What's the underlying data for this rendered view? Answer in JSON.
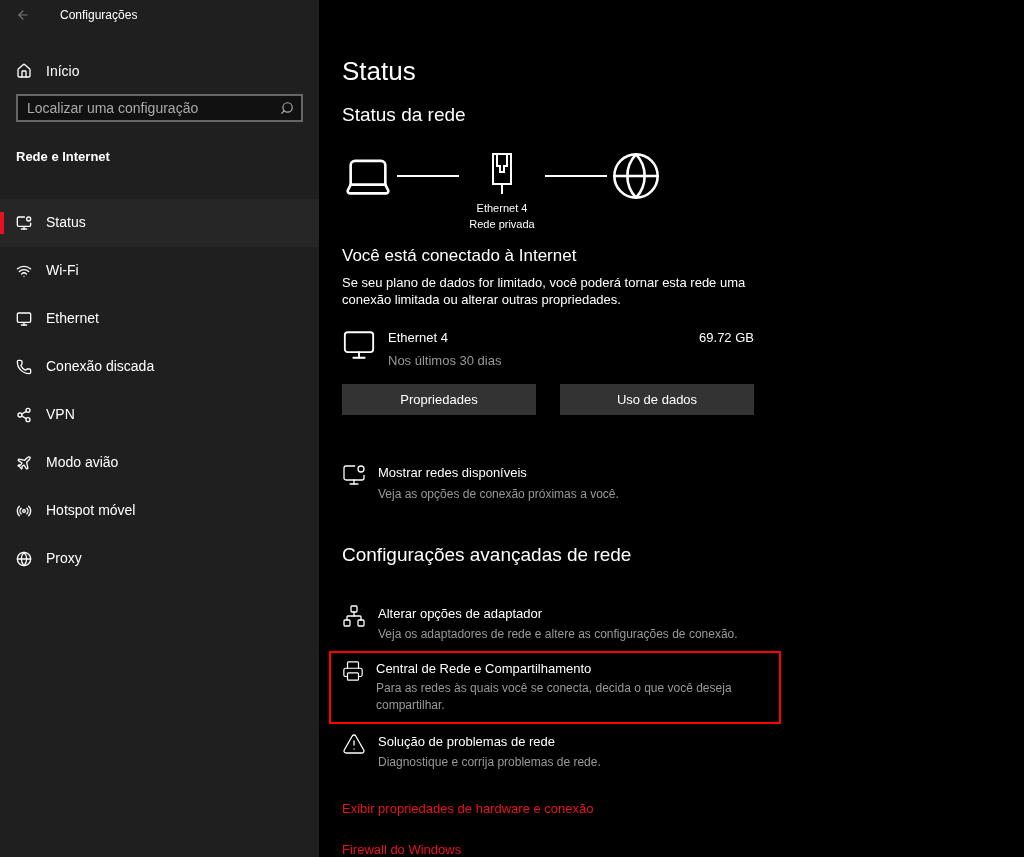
{
  "window": {
    "title": "Configurações"
  },
  "sidebar": {
    "home": "Início",
    "search": {
      "placeholder": "Localizar uma configuração"
    },
    "section": "Rede e Internet",
    "items": [
      {
        "label": "Status",
        "selected": true
      },
      {
        "label": "Wi-Fi",
        "selected": false
      },
      {
        "label": "Ethernet",
        "selected": false
      },
      {
        "label": "Conexão discada",
        "selected": false
      },
      {
        "label": "VPN",
        "selected": false
      },
      {
        "label": "Modo avião",
        "selected": false
      },
      {
        "label": "Hotspot móvel",
        "selected": false
      },
      {
        "label": "Proxy",
        "selected": false
      }
    ]
  },
  "main": {
    "title": "Status",
    "network_status": {
      "heading": "Status da rede",
      "adapter_name": "Ethernet 4",
      "network_type": "Rede privada"
    },
    "connected_heading": "Você está conectado à Internet",
    "description": "Se seu plano de dados for limitado, você poderá tornar esta rede uma conexão limitada ou alterar outras propriedades.",
    "usage": {
      "name": "Ethernet 4",
      "period": "Nos últimos 30 dias",
      "amount": "69.72 GB"
    },
    "buttons": [
      "Propriedades",
      "Uso de dados"
    ],
    "show_networks": {
      "title": "Mostrar redes disponíveis",
      "subtitle": "Veja as opções de conexão próximas a você."
    },
    "advanced_heading": "Configurações avançadas de rede",
    "advanced_items": [
      {
        "title": "Alterar opções de adaptador",
        "subtitle": "Veja os adaptadores de rede e altere as configurações de conexão.",
        "highlighted": false
      },
      {
        "title": "Central de Rede e Compartilhamento",
        "subtitle": "Para as redes às quais você se conecta, decida o que você deseja compartilhar.",
        "highlighted": true
      },
      {
        "title": "Solução de problemas de rede",
        "subtitle": "Diagnostique e corrija problemas de rede.",
        "highlighted": false
      }
    ],
    "links": [
      "Exibir propriedades de hardware e conexão",
      "Firewall do Windows"
    ]
  }
}
